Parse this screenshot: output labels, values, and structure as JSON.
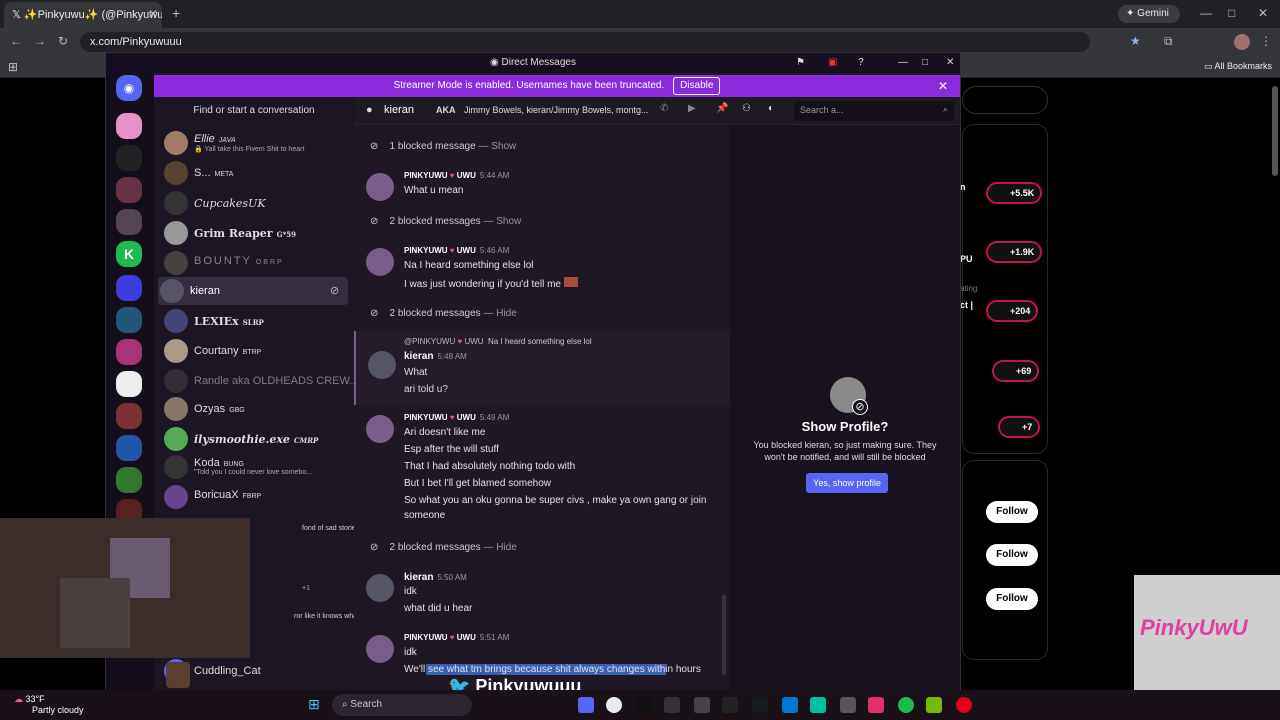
{
  "browser": {
    "tab_title": "✨Pinkyuwu✨ (@Pinkyuwu...",
    "url": "x.com/Pinkyuwuuu",
    "gemini_label": "Gemini",
    "bookmarks_label": "All Bookmarks"
  },
  "twitter_bg": {
    "counts": [
      "+5.5K",
      "+1.9K",
      "+204",
      "+69",
      "+7"
    ],
    "follow_label": "Follow",
    "snips": [
      "n",
      "PU",
      "ating",
      "ct |"
    ]
  },
  "discord": {
    "window_title": "Direct Messages",
    "streamer_banner": "Streamer Mode is enabled. Usernames have been truncated.",
    "disable_label": "Disable",
    "find_conversation": "Find or start a conversation",
    "dm_list": [
      {
        "name": "Ellie",
        "tag": "JAVA",
        "sub": "🔒 Yall take this Fivem Shit to heart"
      },
      {
        "name": "S...",
        "tag": "META",
        "sub": ""
      },
      {
        "name": "CupcakesUK",
        "tag": "",
        "sub": ""
      },
      {
        "name": "Grim Reaper",
        "tag": "G*59",
        "sub": ""
      },
      {
        "name": "BOUNTY",
        "tag": "OBRP",
        "sub": ""
      },
      {
        "name": "kieran",
        "tag": "",
        "sub": ""
      },
      {
        "name": "LEXIEx",
        "tag": "SLRP",
        "sub": ""
      },
      {
        "name": "Courtany",
        "tag": "BTRP",
        "sub": ""
      },
      {
        "name": "Randle aka OLDHEADS CREW...",
        "tag": "",
        "sub": ""
      },
      {
        "name": "Ozyas",
        "tag": "GBG",
        "sub": ""
      },
      {
        "name": "ilysmoothie.exe",
        "tag": "CMRP",
        "sub": ""
      },
      {
        "name": "Koda",
        "tag": "BUNG",
        "sub": "\"Told you I could never love somebo..."
      },
      {
        "name": "BoricuaX",
        "tag": "FBRP",
        "sub": ""
      }
    ],
    "dm_snips": [
      "fond of sad stories\"",
      "+1",
      "ror like it knows what I n..."
    ],
    "cuddling_cat": "Cuddling_Cat",
    "chat_header": {
      "name": "kieran",
      "aka": "AKA",
      "aka_names": "Jimmy Bowels, kieran/Jimmy Bowels, montg...",
      "search_placeholder": "Search a..."
    },
    "messages": {
      "b1": "1 blocked message",
      "b1_link": "— Show",
      "m1_author": "PINKYUWU",
      "m1_badge": "UWU",
      "m1_time": "5:44 AM",
      "m1_l1": "What u mean",
      "b2": "2 blocked messages",
      "b2_link": "— Show",
      "m2_author": "PINKYUWU",
      "m2_badge": "UWU",
      "m2_time": "5:46 AM",
      "m2_l1": "Na I heard something else lol",
      "m2_l2": "I was just wondering if you'd tell me",
      "b3": "2 blocked messages",
      "b3_link": "— Hide",
      "r_author": "@PINKYUWU",
      "r_badge": "UWU",
      "r_text": "Na I heard something else lol",
      "m3_author": "kieran",
      "m3_time": "5:48 AM",
      "m3_l1": "What",
      "m3_l2": "ari told u?",
      "m4_author": "PINKYUWU",
      "m4_badge": "UWU",
      "m4_time": "5:49 AM",
      "m4_l1": "Ari doesn't like me",
      "m4_l2": "Esp after the will stuff",
      "m4_l3": "That I had absolutely nothing todo with",
      "m4_l4": "But I bet I'll get blamed somehow",
      "m4_l5": "So what you an oku gonna be super civs , make ya own gang or join",
      "m4_l6": "someone",
      "b4": "2 blocked messages",
      "b4_link": "— Hide",
      "m5_author": "kieran",
      "m5_time": "5:50 AM",
      "m5_l1": "idk",
      "m5_l2": "what did u hear",
      "m6_author": "PINKYUWU",
      "m6_badge": "UWU",
      "m6_time": "5:51 AM",
      "m6_l1": "idk",
      "m6_l2": "We'll see what tm brings because shit always changes within hours"
    },
    "profile": {
      "title": "Show Profile?",
      "text": "You blocked kieran, so just making sure. They won't be notified, and will still be blocked",
      "button": "Yes, show profile"
    }
  },
  "overlay": {
    "name": "Pinkyuwuuu",
    "logo_text": "PinkyUwU"
  },
  "taskbar": {
    "temp": "33°F",
    "weather": "Partly cloudy",
    "search": "Search"
  }
}
